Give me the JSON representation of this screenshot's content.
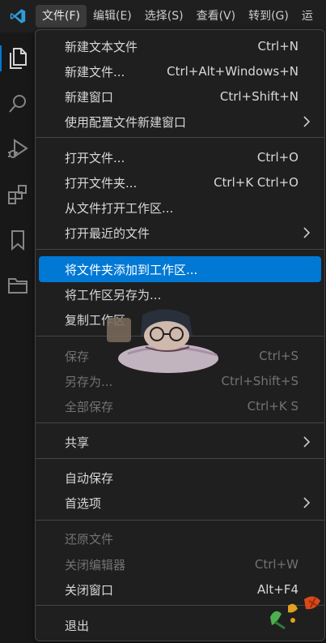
{
  "menubar": {
    "items": [
      "文件(F)",
      "编辑(E)",
      "选择(S)",
      "查看(V)",
      "转到(G)",
      "运"
    ]
  },
  "activitybar": {
    "icons": [
      "explorer-icon",
      "search-icon",
      "run-debug-icon",
      "extensions-icon",
      "bookmark-icon",
      "folder-icon"
    ]
  },
  "file_menu": {
    "items": [
      {
        "label": "新建文本文件",
        "shortcut": "Ctrl+N"
      },
      {
        "label": "新建文件...",
        "shortcut": "Ctrl+Alt+Windows+N"
      },
      {
        "label": "新建窗口",
        "shortcut": "Ctrl+Shift+N"
      },
      {
        "label": "使用配置文件新建窗口",
        "shortcut": ""
      },
      {
        "label": "打开文件...",
        "shortcut": "Ctrl+O"
      },
      {
        "label": "打开文件夹...",
        "shortcut": "Ctrl+K Ctrl+O"
      },
      {
        "label": "从文件打开工作区...",
        "shortcut": ""
      },
      {
        "label": "打开最近的文件",
        "shortcut": ""
      },
      {
        "label": "将文件夹添加到工作区...",
        "shortcut": ""
      },
      {
        "label": "将工作区另存为...",
        "shortcut": ""
      },
      {
        "label": "复制工作区",
        "shortcut": ""
      },
      {
        "label": "保存",
        "shortcut": "Ctrl+S"
      },
      {
        "label": "另存为...",
        "shortcut": "Ctrl+Shift+S"
      },
      {
        "label": "全部保存",
        "shortcut": "Ctrl+K S"
      },
      {
        "label": "共享",
        "shortcut": ""
      },
      {
        "label": "自动保存",
        "shortcut": ""
      },
      {
        "label": "首选项",
        "shortcut": ""
      },
      {
        "label": "还原文件",
        "shortcut": ""
      },
      {
        "label": "关闭编辑器",
        "shortcut": "Ctrl+W"
      },
      {
        "label": "关闭窗口",
        "shortcut": "Alt+F4"
      },
      {
        "label": "退出",
        "shortcut": ""
      }
    ]
  },
  "colors": {
    "accent": "#0078d4",
    "menu_bg": "#1f1f1f",
    "disabled_text": "#727272"
  }
}
